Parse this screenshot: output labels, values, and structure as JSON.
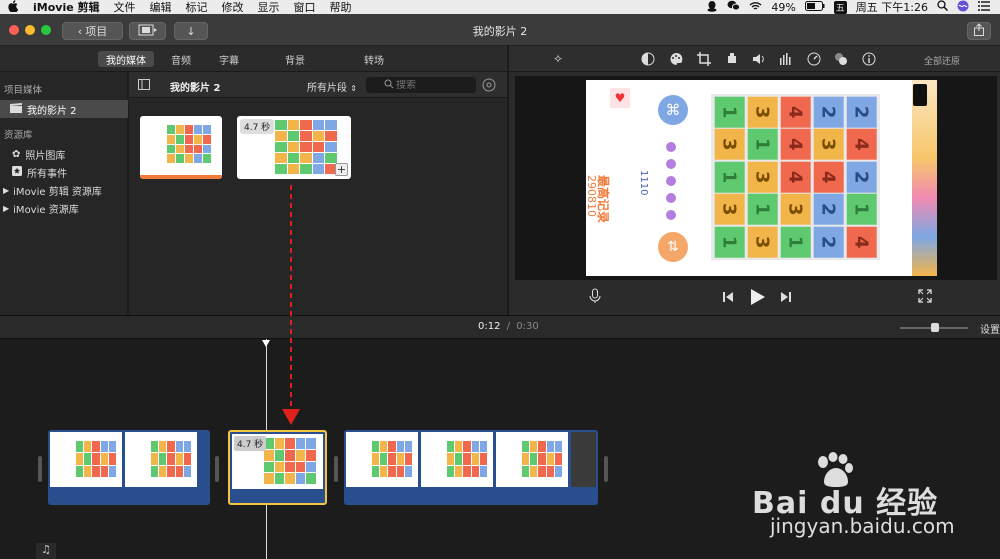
{
  "menubar": {
    "app_name": "iMovie 剪辑",
    "items": [
      "文件",
      "编辑",
      "标记",
      "修改",
      "显示",
      "窗口",
      "帮助"
    ],
    "battery": "49%",
    "input_method": "五",
    "clock": "周五 下午1:26"
  },
  "titlebar": {
    "back_label": "项目",
    "window_title": "我的影片 2"
  },
  "tabs": [
    "我的媒体",
    "音频",
    "字幕",
    "背景",
    "转场"
  ],
  "sidebar": {
    "section1": "项目媒体",
    "project": "我的影片 2",
    "section2": "资源库",
    "photos": "照片图库",
    "events": "所有事件",
    "lib1": "iMovie 剪辑 资源库",
    "lib2": "iMovie 资源库"
  },
  "browser": {
    "title": "我的影片 2",
    "filter": "所有片段",
    "search_placeholder": "搜索",
    "clip_duration": "4.7 秒"
  },
  "viewer": {
    "reset_label": "全部还原",
    "frame_record_label": "最高记录",
    "frame_record_value": "290810",
    "frame_score": "1110",
    "grid": [
      [
        {
          "v": "1",
          "c": "g"
        },
        {
          "v": "3",
          "c": "o"
        },
        {
          "v": "4",
          "c": "r"
        },
        {
          "v": "2",
          "c": "b"
        },
        {
          "v": "2",
          "c": "b"
        }
      ],
      [
        {
          "v": "3",
          "c": "o"
        },
        {
          "v": "1",
          "c": "g"
        },
        {
          "v": "4",
          "c": "r"
        },
        {
          "v": "3",
          "c": "o"
        },
        {
          "v": "4",
          "c": "r"
        }
      ],
      [
        {
          "v": "1",
          "c": "g"
        },
        {
          "v": "3",
          "c": "o"
        },
        {
          "v": "4",
          "c": "r"
        },
        {
          "v": "4",
          "c": "r"
        },
        {
          "v": "2",
          "c": "b"
        }
      ],
      [
        {
          "v": "3",
          "c": "o"
        },
        {
          "v": "1",
          "c": "g"
        },
        {
          "v": "3",
          "c": "o"
        },
        {
          "v": "2",
          "c": "b"
        },
        {
          "v": "1",
          "c": "g"
        }
      ],
      [
        {
          "v": "1",
          "c": "g"
        },
        {
          "v": "3",
          "c": "o"
        },
        {
          "v": "1",
          "c": "g"
        },
        {
          "v": "2",
          "c": "b"
        },
        {
          "v": "4",
          "c": "r"
        }
      ]
    ]
  },
  "timeline": {
    "current_time": "0:12",
    "separator": "/",
    "total_time": "0:30",
    "settings_label": "设置",
    "clip_duration": "4.7 秒"
  },
  "watermark": {
    "brand": "Bai  du 经验",
    "url": "jingyan.baidu.com"
  },
  "colors": {
    "arrow": "#e0201b",
    "selected_clip_border": "#f5c542",
    "audio_strip": "#2a4f8e"
  }
}
